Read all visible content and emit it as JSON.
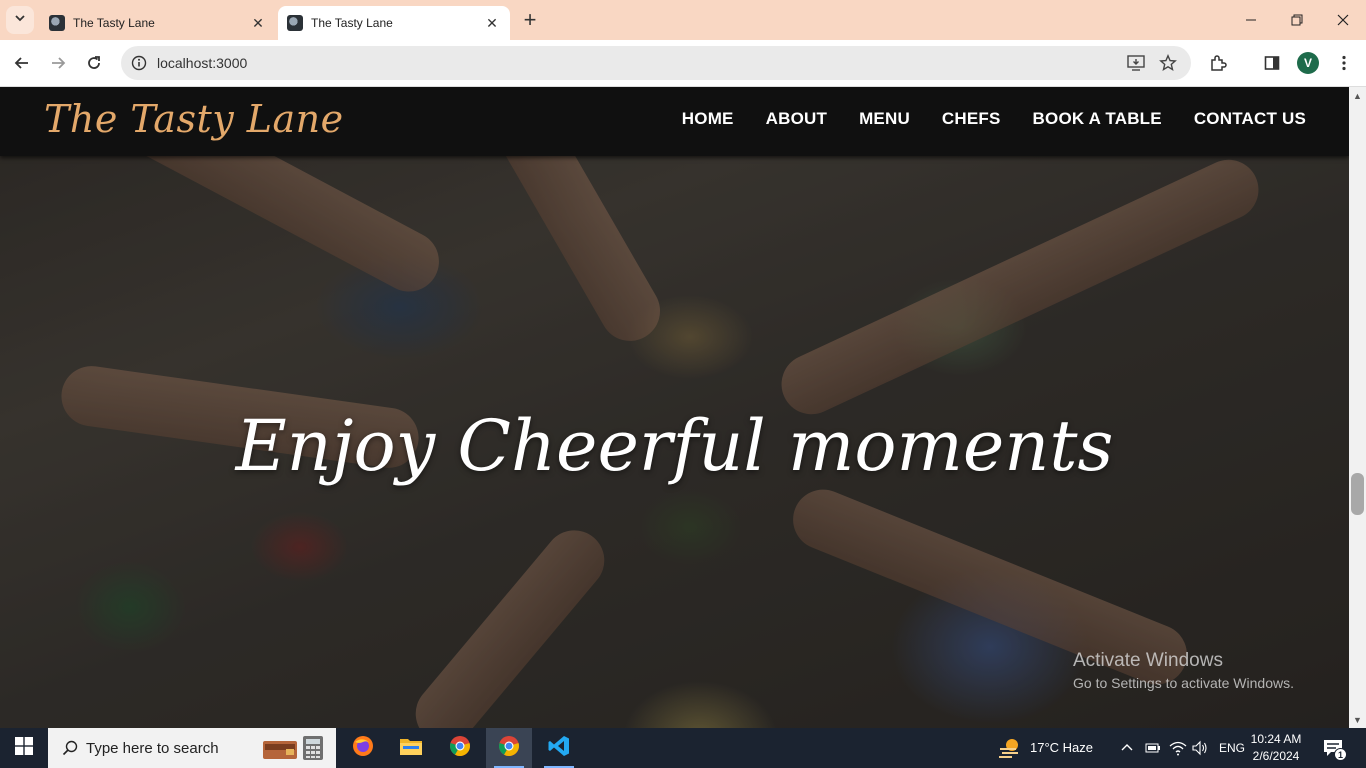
{
  "browser": {
    "tabs": [
      {
        "title": "The Tasty Lane",
        "active": false
      },
      {
        "title": "The Tasty Lane",
        "active": true
      }
    ],
    "address": "localhost:3000",
    "profile_initial": "V"
  },
  "site": {
    "logo": "The Tasty Lane",
    "nav": [
      "HOME",
      "ABOUT",
      "MENU",
      "CHEFS",
      "BOOK A TABLE",
      "CONTACT US"
    ],
    "hero_title": "Enjoy Cheerful moments"
  },
  "watermark": {
    "line1": "Activate Windows",
    "line2": "Go to Settings to activate Windows."
  },
  "taskbar": {
    "search_placeholder": "Type here to search",
    "weather": "17°C  Haze",
    "language": "ENG",
    "time": "10:24 AM",
    "date": "2/6/2024",
    "notifications": "1"
  },
  "colors": {
    "tab_strip": "#f9d7c3",
    "logo": "#e3a86a",
    "header_bg": "#101010",
    "taskbar_bg": "#1b2330"
  }
}
